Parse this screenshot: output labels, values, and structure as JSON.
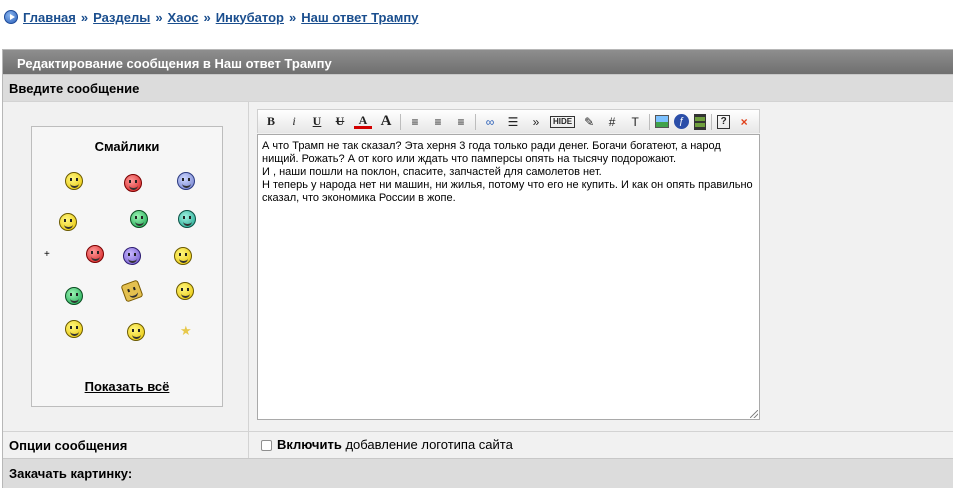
{
  "breadcrumb": {
    "items": [
      "Главная",
      "Разделы",
      "Хаос",
      "Инкубатор",
      "Наш ответ Трампу"
    ],
    "separator": "»"
  },
  "header": {
    "title": "Редактирование сообщения в Наш ответ Трампу"
  },
  "labels": {
    "enter_message": "Введите сообщение",
    "message_options": "Опции сообщения",
    "upload_image": "Закачать картинку:"
  },
  "smilies": {
    "title": "Смайлики",
    "show_all": "Показать всё",
    "plus": "+"
  },
  "toolbar": {
    "bold": "B",
    "italic": "i",
    "underline": "U",
    "strike": "U",
    "color": "A",
    "size": "A",
    "more": "»",
    "hide": "HIDE",
    "hash": "#",
    "text": "T",
    "help": "?",
    "close": "×"
  },
  "editor": {
    "text": "А что Трамп не так сказал? Эта херня 3 года только ради денег. Богачи богатеют, а народ нищий. Рожать? А от кого или ждать что памперсы опять на тысячу подорожают.\nИ , наши пошли на поклон, спасите, запчастей для самолетов нет.\nН теперь у народа нет ни машин, ни жилья, потому что его не купить. И как он опять правильно сказал, что экономика России в жопе."
  },
  "options": {
    "logo_bold": "Включить",
    "logo_rest": " добавление логотипа сайта",
    "logo_checked": false
  }
}
